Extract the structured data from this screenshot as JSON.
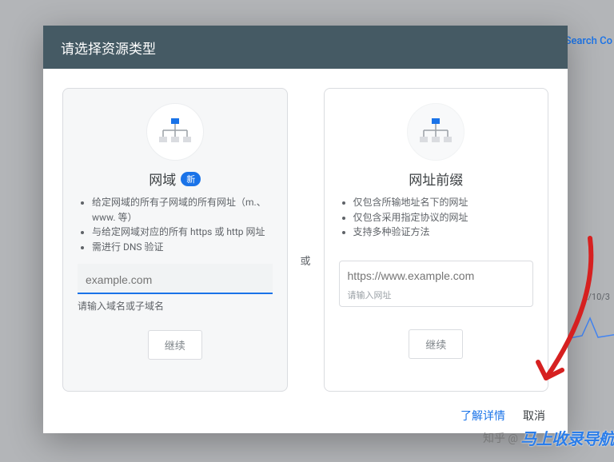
{
  "background": {
    "search_console_label": "Search Co",
    "date_fragment": "2/10/3"
  },
  "dialog": {
    "title": "请选择资源类型",
    "or_label": "或",
    "learn_more": "了解详情",
    "cancel": "取消",
    "domain_card": {
      "icon": "sitemap-icon",
      "title": "网域",
      "new_badge": "新",
      "bullets": [
        "给定网域的所有子网域的所有网址（m.、www. 等）",
        "与给定网域对应的所有 https 或 http 网址",
        "需进行 DNS 验证"
      ],
      "placeholder": "example.com",
      "helper": "请输入域名或子域名",
      "continue": "继续"
    },
    "prefix_card": {
      "icon": "sitemap-icon",
      "title": "网址前缀",
      "bullets": [
        "仅包含所输地址名下的网址",
        "仅包含采用指定协议的网址",
        "支持多种验证方法"
      ],
      "placeholder": "https://www.example.com",
      "helper": "请输入网址",
      "continue": "继续"
    }
  },
  "watermark1": "知乎 @",
  "watermark2": "马上收录导航"
}
